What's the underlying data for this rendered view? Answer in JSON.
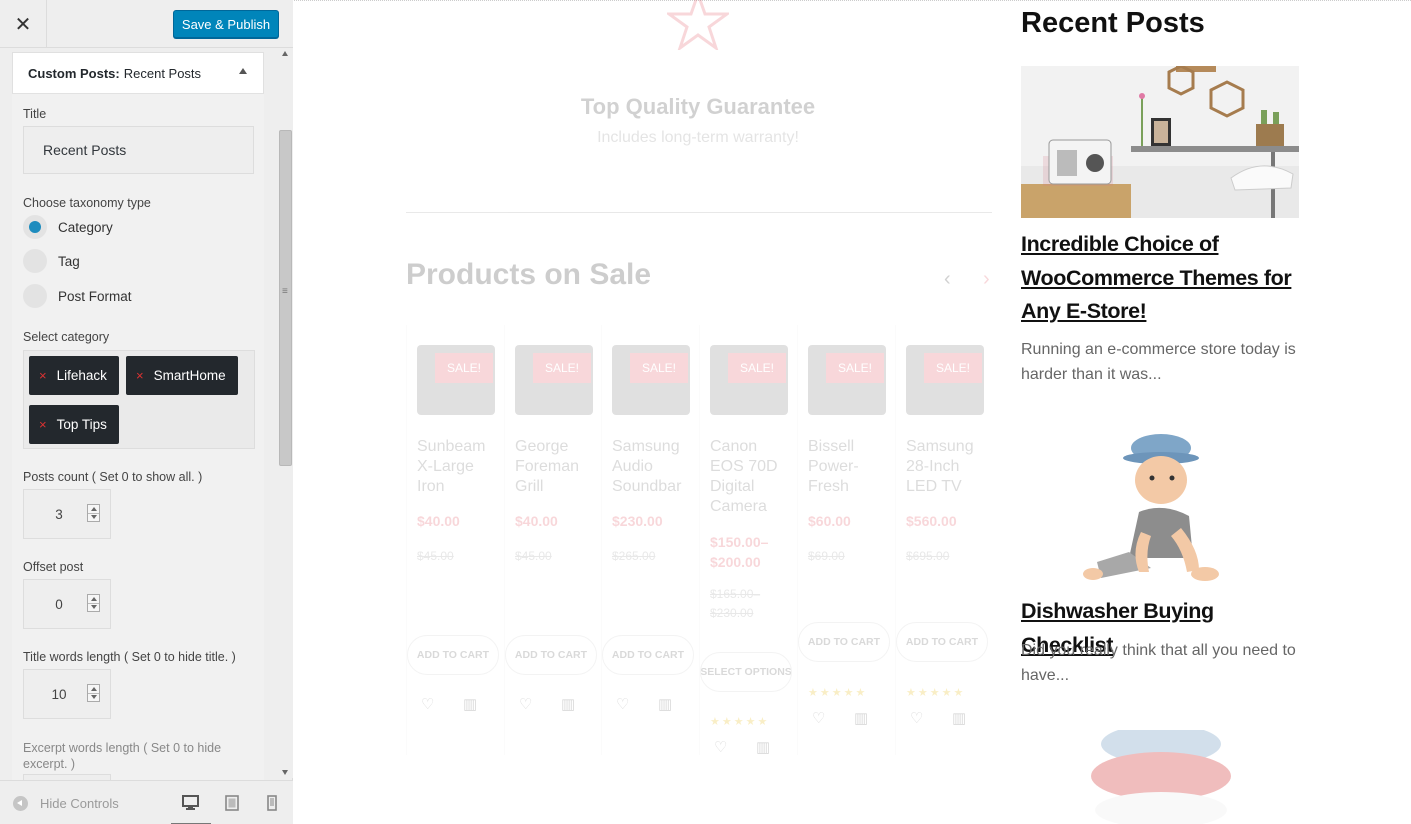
{
  "customizer": {
    "close_glyph": "✕",
    "publish_label": "Save & Publish",
    "panel_section": "Custom Posts:",
    "panel_title": "Recent Posts",
    "title_label": "Title",
    "title_value": "Recent Posts",
    "taxonomy_label": "Choose taxonomy type",
    "taxonomy_options": [
      "Category",
      "Tag",
      "Post Format"
    ],
    "taxonomy_selected": "Category",
    "category_label": "Select category",
    "categories": [
      "Lifehack",
      "SmartHome",
      "Top Tips"
    ],
    "remove_glyph": "×",
    "posts_count_label": "Posts count ( Set 0 to show all. )",
    "posts_count": "3",
    "offset_label": "Offset post",
    "offset": "0",
    "title_words_label": "Title words length ( Set 0 to hide title. )",
    "title_words": "10",
    "excerpt_label": "Excerpt words length ( Set 0 to hide excerpt. )",
    "hide_controls": "Hide Controls",
    "devices": [
      "desktop-icon",
      "tablet-icon",
      "mobile-icon"
    ],
    "accent": "#0085ba"
  },
  "preview": {
    "guarantee_title": "Top Quality Guarantee",
    "guarantee_sub": "Includes long-term warranty!",
    "sale_heading": "Products on Sale",
    "prev_glyph": "‹",
    "next_glyph": "›",
    "products": [
      {
        "name": "Sunbeam X-Large Iron",
        "price": "$40.00",
        "old": "$45.00",
        "sale": "SALE!",
        "button": "ADD TO CART"
      },
      {
        "name": "George Foreman Grill",
        "price": "$40.00",
        "old": "$45.00",
        "sale": "SALE!",
        "button": "ADD TO CART"
      },
      {
        "name": "Samsung Audio Soundbar",
        "price": "$230.00",
        "old": "$265.00",
        "sale": "SALE!",
        "button": "ADD TO CART"
      },
      {
        "name": "Canon EOS 70D Digital Camera",
        "price": "$150.00–$200.00",
        "old": "$165.00–$230.00",
        "sale": "SALE!",
        "button": "SELECT OPTIONS"
      },
      {
        "name": "Bissell Power-Fresh",
        "price": "$60.00",
        "old": "$69.00",
        "sale": "SALE!",
        "button": "ADD TO CART"
      },
      {
        "name": "Samsung 28-Inch LED TV",
        "price": "$560.00",
        "old": "$695.00",
        "sale": "SALE!",
        "button": "ADD TO CART"
      }
    ],
    "recent_heading": "Recent Posts",
    "posts": [
      {
        "title": "Incredible Choice of WooCommerce Themes for Any E-Store!",
        "excerpt": "Running an e-commerce store today is harder than it was..."
      },
      {
        "title": "Dishwasher Buying Checklist",
        "excerpt": "Did you really think that all you need to have..."
      }
    ],
    "sale_color": "#e04d5b"
  }
}
